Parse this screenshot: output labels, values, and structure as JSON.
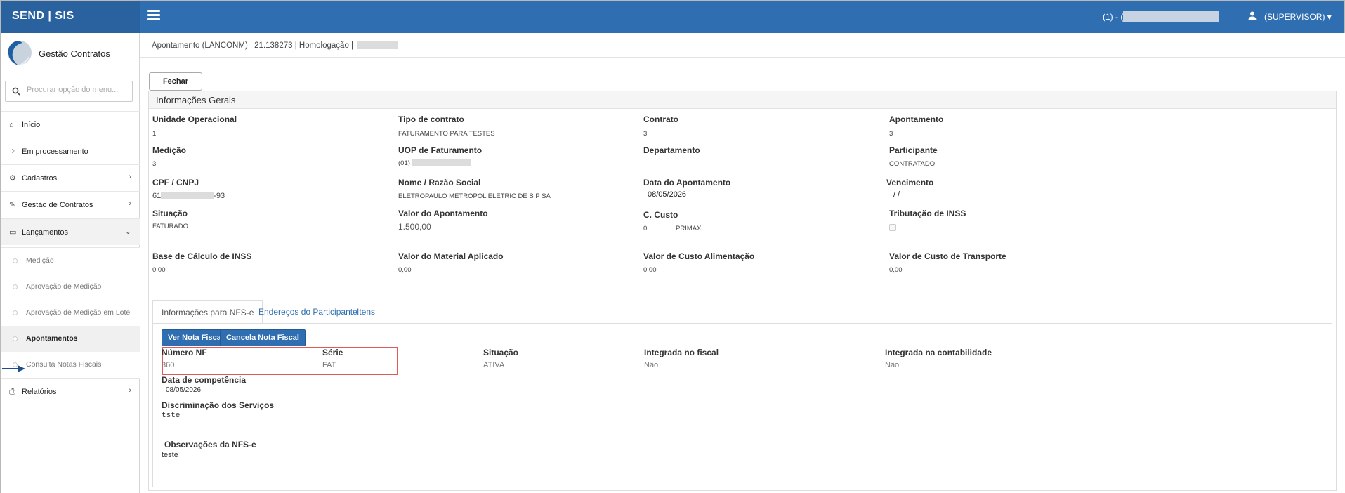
{
  "topbar": {
    "brand": "SEND | SIS",
    "code_prefix": "(1) - (",
    "user": "(SUPERVISOR) ▾"
  },
  "sidebar": {
    "app_name": "Gestão Contratos",
    "search_placeholder": "Procurar opção do menu...",
    "items": [
      {
        "label": "Início"
      },
      {
        "label": "Em processamento"
      },
      {
        "label": "Cadastros"
      },
      {
        "label": "Gestão de Contratos"
      },
      {
        "label": "Lançamentos"
      },
      {
        "label": "Relatórios"
      }
    ],
    "subitems": [
      {
        "label": "Medição"
      },
      {
        "label": "Aprovação de Medição"
      },
      {
        "label": "Aprovação de Medição em Lote"
      },
      {
        "label": "Apontamentos"
      },
      {
        "label": "Consulta Notas Fiscais"
      }
    ]
  },
  "breadcrumb": "Apontamento (LANCONM) | 21.138273 | Homologação | ",
  "close_label": "Fechar",
  "panel_title": "Informações Gerais",
  "fields": {
    "unidade_label": "Unidade Operacional",
    "unidade_value": "1",
    "tipo_label": "Tipo de contrato",
    "tipo_value": "FATURAMENTO PARA TESTES",
    "contrato_label": "Contrato",
    "contrato_value": "3",
    "apont_label": "Apontamento",
    "apont_value": "3",
    "medicao_label": "Medição",
    "medicao_value": "3",
    "uop_label": "UOP de Faturamento",
    "uop_value": "(01)",
    "depto_label": "Departamento",
    "part_label": "Participante",
    "part_value": "CONTRATADO",
    "cpf_label": "CPF / CNPJ",
    "cpf_prefix": "61",
    "cpf_suffix": "-93",
    "nome_label": "Nome / Razão Social",
    "nome_value": "ELETROPAULO METROPOL ELETRIC DE S P SA",
    "data_apont_label": "Data do Apontamento",
    "data_apont_value": "08/05/2026",
    "venc_label": "Vencimento",
    "venc_value": "/ /",
    "situacao_label": "Situação",
    "situacao_value": "FATURADO",
    "valor_label": "Valor do Apontamento",
    "valor_value": "1.500,00",
    "ccusto_label": "C. Custo",
    "ccusto_code": "0",
    "ccusto_name": "PRIMAX",
    "inss_label": "Tributação de INSS",
    "base_label": "Base de Cálculo de INSS",
    "base_value": "0,00",
    "material_label": "Valor do Material Aplicado",
    "material_value": "0,00",
    "alim_label": "Valor de Custo Alimentação",
    "alim_value": "0,00",
    "transp_label": "Valor de Custo de Transporte",
    "transp_value": "0,00"
  },
  "tabs": [
    {
      "label": "Informações para NFS-e"
    },
    {
      "label": "Endereços do Participante"
    },
    {
      "label": "Itens"
    }
  ],
  "nfse": {
    "btn_ver": "Ver Nota Fiscal",
    "btn_cancela": "Cancela Nota Fiscal",
    "numero_label": "Número NF",
    "numero_value": "360",
    "serie_label": "Série",
    "serie_value": "FAT",
    "situacao_label": "Situação",
    "situacao_value": "ATIVA",
    "fiscal_label": "Integrada no fiscal",
    "fiscal_value": "Não",
    "contab_label": "Integrada na contabilidade",
    "contab_value": "Não",
    "competencia_label": "Data de competência",
    "competencia_value": "08/05/2026",
    "discrim_label": "Discriminação dos Serviços",
    "discrim_value": "tste",
    "obs_label": "Observações da NFS-e",
    "obs_value": "teste"
  },
  "colors": {
    "topbar": "#2f6fb1",
    "accent": "#2f6fb1",
    "highlight": "#e05a5a"
  }
}
